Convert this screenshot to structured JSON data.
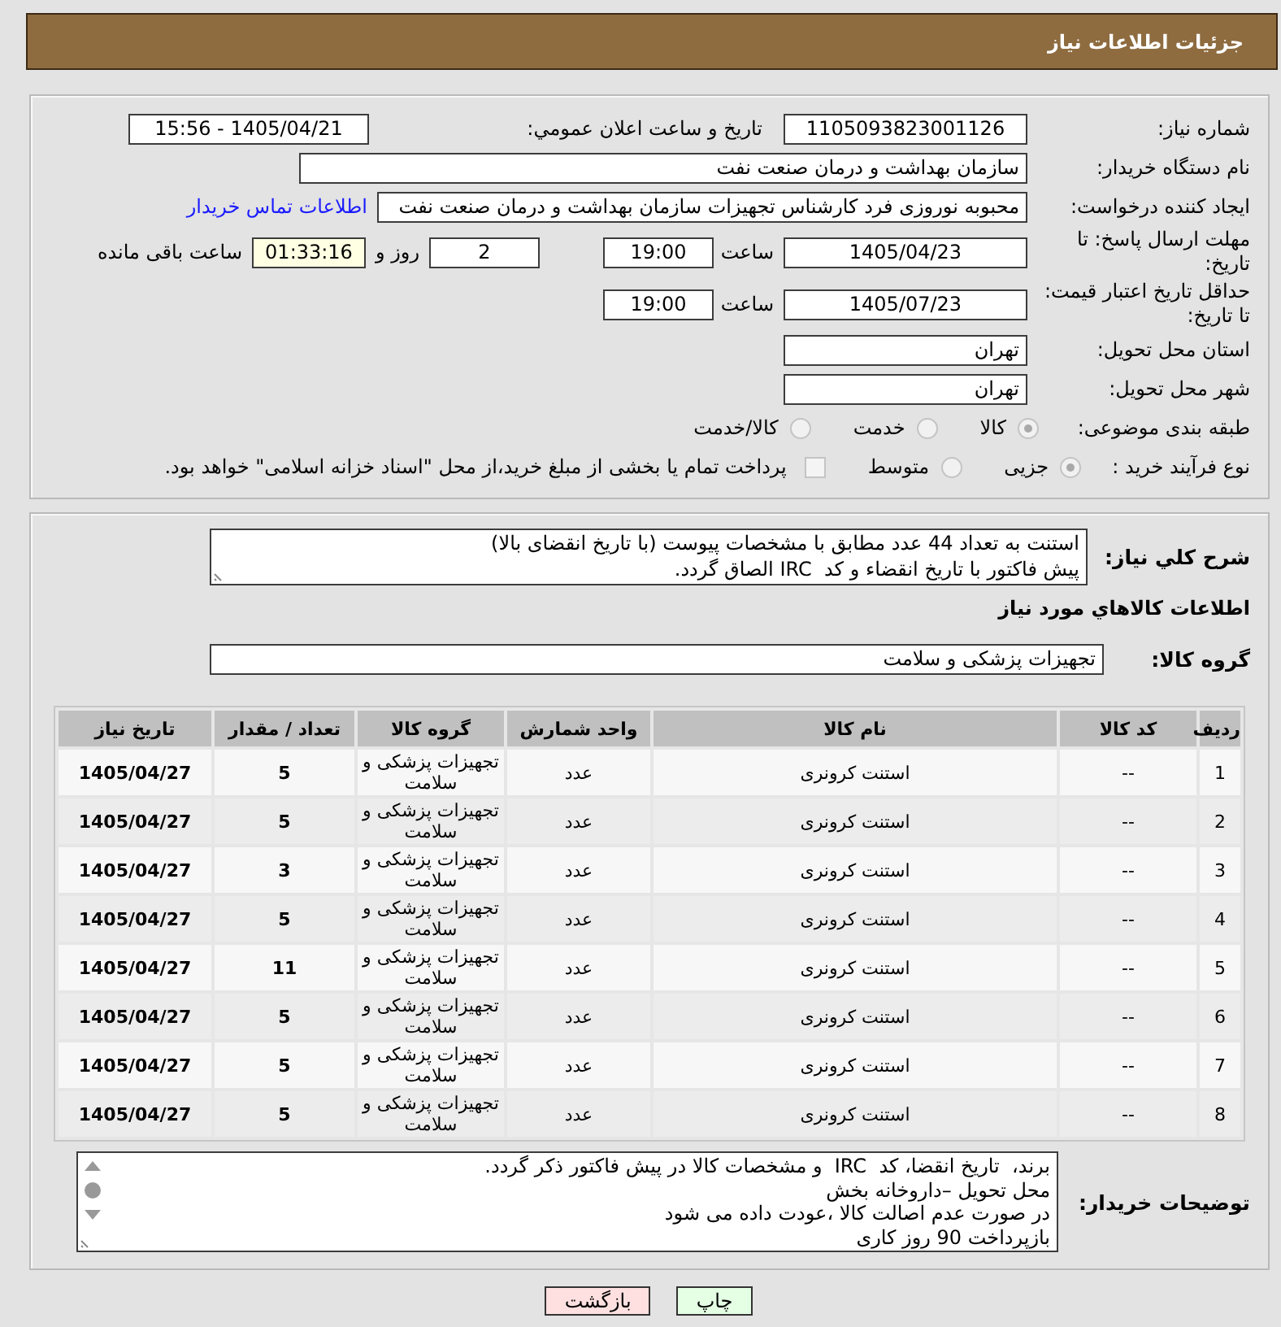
{
  "header": {
    "title": "جزئیات اطلاعات نیاز"
  },
  "details": {
    "need_number": {
      "label": "شماره نیاز:",
      "value": "1105093823001126"
    },
    "announce": {
      "label": "تاریخ و ساعت اعلان عمومي:",
      "value": "1405/04/21 - 15:56"
    },
    "buyer_org": {
      "label": "نام دستگاه خریدار:",
      "value": "سازمان بهداشت و درمان صنعت نفت"
    },
    "requester": {
      "label": "ایجاد کننده درخواست:",
      "value": "محبوبه نوروزی فرد کارشناس تجهیزات سازمان بهداشت و درمان صنعت نفت",
      "link": "اطلاعات تماس خریدار"
    },
    "deadline": {
      "label": "مهلت ارسال پاسخ: تا تاریخ:",
      "date": "1405/04/23",
      "time_label": "ساعت",
      "time": "19:00",
      "days": "2",
      "days_label": "روز و",
      "remaining": "01:33:16",
      "remaining_label": "ساعت باقی مانده"
    },
    "validity": {
      "label": "حداقل تاریخ اعتبار قیمت: تا تاریخ:",
      "date": "1405/07/23",
      "time_label": "ساعت",
      "time": "19:00"
    },
    "province": {
      "label": "استان محل تحویل:",
      "value": "تهران"
    },
    "city": {
      "label": "شهر محل تحویل:",
      "value": "تهران"
    },
    "category": {
      "label": "طبقه بندی موضوعی:",
      "options": [
        {
          "label": "کالا",
          "selected": true
        },
        {
          "label": "خدمت",
          "selected": false
        },
        {
          "label": "کالا/خدمت",
          "selected": false
        }
      ]
    },
    "process": {
      "label": "نوع فرآیند خرید :",
      "options": [
        {
          "label": "جزیی",
          "selected": true
        },
        {
          "label": "متوسط",
          "selected": false
        }
      ],
      "treasury": {
        "label": "پرداخت تمام یا بخشی از مبلغ خرید،از محل \"اسناد خزانه اسلامی\" خواهد بود.",
        "checked": false
      }
    }
  },
  "description": {
    "label": "شرح کلي نياز:",
    "text": "استنت به تعداد 44 عدد مطابق با مشخصات پیوست (با تاریخ انقضای بالا)\nپیش فاکتور با تاریخ انقضاء و کد  IRC الصاق گردد."
  },
  "goods": {
    "title": "اطلاعات کالاهاي مورد نياز",
    "group": {
      "label": "گروه کالا:",
      "value": "تجهیزات پزشکی و سلامت"
    },
    "table": {
      "columns": [
        "ردیف",
        "کد کالا",
        "نام کالا",
        "واحد شمارش",
        "گروه کالا",
        "تعداد / مقدار",
        "تاریخ نیاز"
      ],
      "rows": [
        [
          "1",
          "--",
          "استنت کرونری",
          "عدد",
          "تجهیزات پزشکی و سلامت",
          "5",
          "1405/04/27"
        ],
        [
          "2",
          "--",
          "استنت کرونری",
          "عدد",
          "تجهیزات پزشکی و سلامت",
          "5",
          "1405/04/27"
        ],
        [
          "3",
          "--",
          "استنت کرونری",
          "عدد",
          "تجهیزات پزشکی و سلامت",
          "3",
          "1405/04/27"
        ],
        [
          "4",
          "--",
          "استنت کرونری",
          "عدد",
          "تجهیزات پزشکی و سلامت",
          "5",
          "1405/04/27"
        ],
        [
          "5",
          "--",
          "استنت کرونری",
          "عدد",
          "تجهیزات پزشکی و سلامت",
          "11",
          "1405/04/27"
        ],
        [
          "6",
          "--",
          "استنت کرونری",
          "عدد",
          "تجهیزات پزشکی و سلامت",
          "5",
          "1405/04/27"
        ],
        [
          "7",
          "--",
          "استنت کرونری",
          "عدد",
          "تجهیزات پزشکی و سلامت",
          "5",
          "1405/04/27"
        ],
        [
          "8",
          "--",
          "استنت کرونری",
          "عدد",
          "تجهیزات پزشکی و سلامت",
          "5",
          "1405/04/27"
        ]
      ]
    }
  },
  "buyer_notes": {
    "label": "توضیحات خریدار:",
    "text": "برند،  تاریخ انقضا، کد  IRC  و مشخصات کالا در پیش فاکتور ذکر گردد.\nمحل تحویل –داروخانه بخش\nدر صورت عدم اصالت کالا ،عودت داده می شود\nبازپرداخت 90 روز کاری"
  },
  "buttons": [
    {
      "label": "چاپ",
      "kind": "print"
    },
    {
      "label": "بازگشت",
      "kind": "back"
    }
  ]
}
